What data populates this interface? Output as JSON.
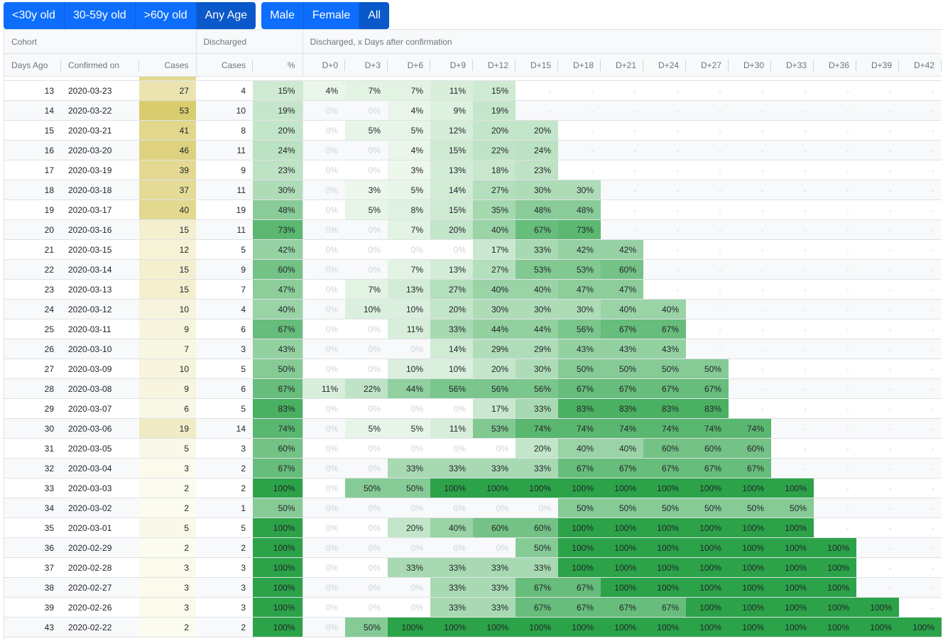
{
  "filters": {
    "age": [
      "<30y old",
      "30-59y old",
      ">60y old",
      "Any Age"
    ],
    "age_active": 3,
    "sex": [
      "Male",
      "Female",
      "All"
    ],
    "sex_active": 2
  },
  "table": {
    "groups": [
      "Cohort",
      "Discharged",
      "Discharged, x Days after confirmation"
    ],
    "columns": [
      "Days Ago",
      "Confirmed on",
      "Cases",
      "Cases",
      "%"
    ],
    "day_columns": [
      "D+0",
      "D+3",
      "D+6",
      "D+9",
      "D+12",
      "D+15",
      "D+18",
      "D+21",
      "D+24",
      "D+27",
      "D+30",
      "D+33",
      "D+36",
      "D+39",
      "D+42"
    ],
    "rows": [
      {
        "ago": "13",
        "date": "2020-03-23",
        "cases": "27",
        "dcases": "4",
        "pct": "15%",
        "days": [
          "4%",
          "7%",
          "7%",
          "11%",
          "15%"
        ]
      },
      {
        "ago": "14",
        "date": "2020-03-22",
        "cases": "53",
        "dcases": "10",
        "pct": "19%",
        "days": [
          "0%",
          "0%",
          "4%",
          "9%",
          "19%"
        ]
      },
      {
        "ago": "15",
        "date": "2020-03-21",
        "cases": "41",
        "dcases": "8",
        "pct": "20%",
        "days": [
          "0%",
          "5%",
          "5%",
          "12%",
          "20%",
          "20%"
        ]
      },
      {
        "ago": "16",
        "date": "2020-03-20",
        "cases": "46",
        "dcases": "11",
        "pct": "24%",
        "days": [
          "0%",
          "0%",
          "4%",
          "15%",
          "22%",
          "24%"
        ]
      },
      {
        "ago": "17",
        "date": "2020-03-19",
        "cases": "39",
        "dcases": "9",
        "pct": "23%",
        "days": [
          "0%",
          "0%",
          "3%",
          "13%",
          "18%",
          "23%"
        ]
      },
      {
        "ago": "18",
        "date": "2020-03-18",
        "cases": "37",
        "dcases": "11",
        "pct": "30%",
        "days": [
          "0%",
          "3%",
          "5%",
          "14%",
          "27%",
          "30%",
          "30%"
        ]
      },
      {
        "ago": "19",
        "date": "2020-03-17",
        "cases": "40",
        "dcases": "19",
        "pct": "48%",
        "days": [
          "0%",
          "5%",
          "8%",
          "15%",
          "35%",
          "48%",
          "48%"
        ]
      },
      {
        "ago": "20",
        "date": "2020-03-16",
        "cases": "15",
        "dcases": "11",
        "pct": "73%",
        "days": [
          "0%",
          "0%",
          "7%",
          "20%",
          "40%",
          "67%",
          "73%"
        ]
      },
      {
        "ago": "21",
        "date": "2020-03-15",
        "cases": "12",
        "dcases": "5",
        "pct": "42%",
        "days": [
          "0%",
          "0%",
          "0%",
          "0%",
          "17%",
          "33%",
          "42%",
          "42%"
        ]
      },
      {
        "ago": "22",
        "date": "2020-03-14",
        "cases": "15",
        "dcases": "9",
        "pct": "60%",
        "days": [
          "0%",
          "0%",
          "7%",
          "13%",
          "27%",
          "53%",
          "53%",
          "60%"
        ]
      },
      {
        "ago": "23",
        "date": "2020-03-13",
        "cases": "15",
        "dcases": "7",
        "pct": "47%",
        "days": [
          "0%",
          "7%",
          "13%",
          "27%",
          "40%",
          "40%",
          "47%",
          "47%"
        ]
      },
      {
        "ago": "24",
        "date": "2020-03-12",
        "cases": "10",
        "dcases": "4",
        "pct": "40%",
        "days": [
          "0%",
          "10%",
          "10%",
          "20%",
          "30%",
          "30%",
          "30%",
          "40%",
          "40%"
        ]
      },
      {
        "ago": "25",
        "date": "2020-03-11",
        "cases": "9",
        "dcases": "6",
        "pct": "67%",
        "days": [
          "0%",
          "0%",
          "11%",
          "33%",
          "44%",
          "44%",
          "56%",
          "67%",
          "67%"
        ]
      },
      {
        "ago": "26",
        "date": "2020-03-10",
        "cases": "7",
        "dcases": "3",
        "pct": "43%",
        "days": [
          "0%",
          "0%",
          "0%",
          "14%",
          "29%",
          "29%",
          "43%",
          "43%",
          "43%"
        ]
      },
      {
        "ago": "27",
        "date": "2020-03-09",
        "cases": "10",
        "dcases": "5",
        "pct": "50%",
        "days": [
          "0%",
          "0%",
          "10%",
          "10%",
          "20%",
          "30%",
          "50%",
          "50%",
          "50%",
          "50%"
        ]
      },
      {
        "ago": "28",
        "date": "2020-03-08",
        "cases": "9",
        "dcases": "6",
        "pct": "67%",
        "days": [
          "11%",
          "22%",
          "44%",
          "56%",
          "56%",
          "56%",
          "67%",
          "67%",
          "67%",
          "67%"
        ]
      },
      {
        "ago": "29",
        "date": "2020-03-07",
        "cases": "6",
        "dcases": "5",
        "pct": "83%",
        "days": [
          "0%",
          "0%",
          "0%",
          "0%",
          "17%",
          "33%",
          "83%",
          "83%",
          "83%",
          "83%"
        ]
      },
      {
        "ago": "30",
        "date": "2020-03-06",
        "cases": "19",
        "dcases": "14",
        "pct": "74%",
        "days": [
          "0%",
          "5%",
          "5%",
          "11%",
          "53%",
          "74%",
          "74%",
          "74%",
          "74%",
          "74%",
          "74%"
        ]
      },
      {
        "ago": "31",
        "date": "2020-03-05",
        "cases": "5",
        "dcases": "3",
        "pct": "60%",
        "days": [
          "0%",
          "0%",
          "0%",
          "0%",
          "0%",
          "20%",
          "40%",
          "40%",
          "60%",
          "60%",
          "60%"
        ]
      },
      {
        "ago": "32",
        "date": "2020-03-04",
        "cases": "3",
        "dcases": "2",
        "pct": "67%",
        "days": [
          "0%",
          "0%",
          "33%",
          "33%",
          "33%",
          "33%",
          "67%",
          "67%",
          "67%",
          "67%",
          "67%"
        ]
      },
      {
        "ago": "33",
        "date": "2020-03-03",
        "cases": "2",
        "dcases": "2",
        "pct": "100%",
        "days": [
          "0%",
          "50%",
          "50%",
          "100%",
          "100%",
          "100%",
          "100%",
          "100%",
          "100%",
          "100%",
          "100%",
          "100%"
        ]
      },
      {
        "ago": "34",
        "date": "2020-03-02",
        "cases": "2",
        "dcases": "1",
        "pct": "50%",
        "days": [
          "0%",
          "0%",
          "0%",
          "0%",
          "0%",
          "0%",
          "50%",
          "50%",
          "50%",
          "50%",
          "50%",
          "50%"
        ]
      },
      {
        "ago": "35",
        "date": "2020-03-01",
        "cases": "5",
        "dcases": "5",
        "pct": "100%",
        "days": [
          "0%",
          "0%",
          "20%",
          "40%",
          "60%",
          "60%",
          "100%",
          "100%",
          "100%",
          "100%",
          "100%",
          "100%"
        ]
      },
      {
        "ago": "36",
        "date": "2020-02-29",
        "cases": "2",
        "dcases": "2",
        "pct": "100%",
        "days": [
          "0%",
          "0%",
          "0%",
          "0%",
          "0%",
          "50%",
          "100%",
          "100%",
          "100%",
          "100%",
          "100%",
          "100%",
          "100%"
        ]
      },
      {
        "ago": "37",
        "date": "2020-02-28",
        "cases": "3",
        "dcases": "3",
        "pct": "100%",
        "days": [
          "0%",
          "0%",
          "33%",
          "33%",
          "33%",
          "33%",
          "100%",
          "100%",
          "100%",
          "100%",
          "100%",
          "100%",
          "100%"
        ]
      },
      {
        "ago": "38",
        "date": "2020-02-27",
        "cases": "3",
        "dcases": "3",
        "pct": "100%",
        "days": [
          "0%",
          "0%",
          "0%",
          "33%",
          "33%",
          "67%",
          "67%",
          "100%",
          "100%",
          "100%",
          "100%",
          "100%",
          "100%"
        ]
      },
      {
        "ago": "39",
        "date": "2020-02-26",
        "cases": "3",
        "dcases": "3",
        "pct": "100%",
        "days": [
          "0%",
          "0%",
          "0%",
          "33%",
          "33%",
          "67%",
          "67%",
          "67%",
          "67%",
          "100%",
          "100%",
          "100%",
          "100%",
          "100%"
        ]
      },
      {
        "ago": "43",
        "date": "2020-02-22",
        "cases": "2",
        "dcases": "2",
        "pct": "100%",
        "days": [
          "0%",
          "50%",
          "100%",
          "100%",
          "100%",
          "100%",
          "100%",
          "100%",
          "100%",
          "100%",
          "100%",
          "100%",
          "100%",
          "100%",
          "100%"
        ]
      }
    ],
    "empty_cell": "-",
    "cases_scale_max": 53
  },
  "colors": {
    "accent": "#0d6efd",
    "accent_active": "#0a58ca",
    "discharge_scale": [
      "#f7fcf5",
      "#2ca349"
    ],
    "cases_scale": [
      "#fdfdf5",
      "#d9cc6e"
    ]
  }
}
